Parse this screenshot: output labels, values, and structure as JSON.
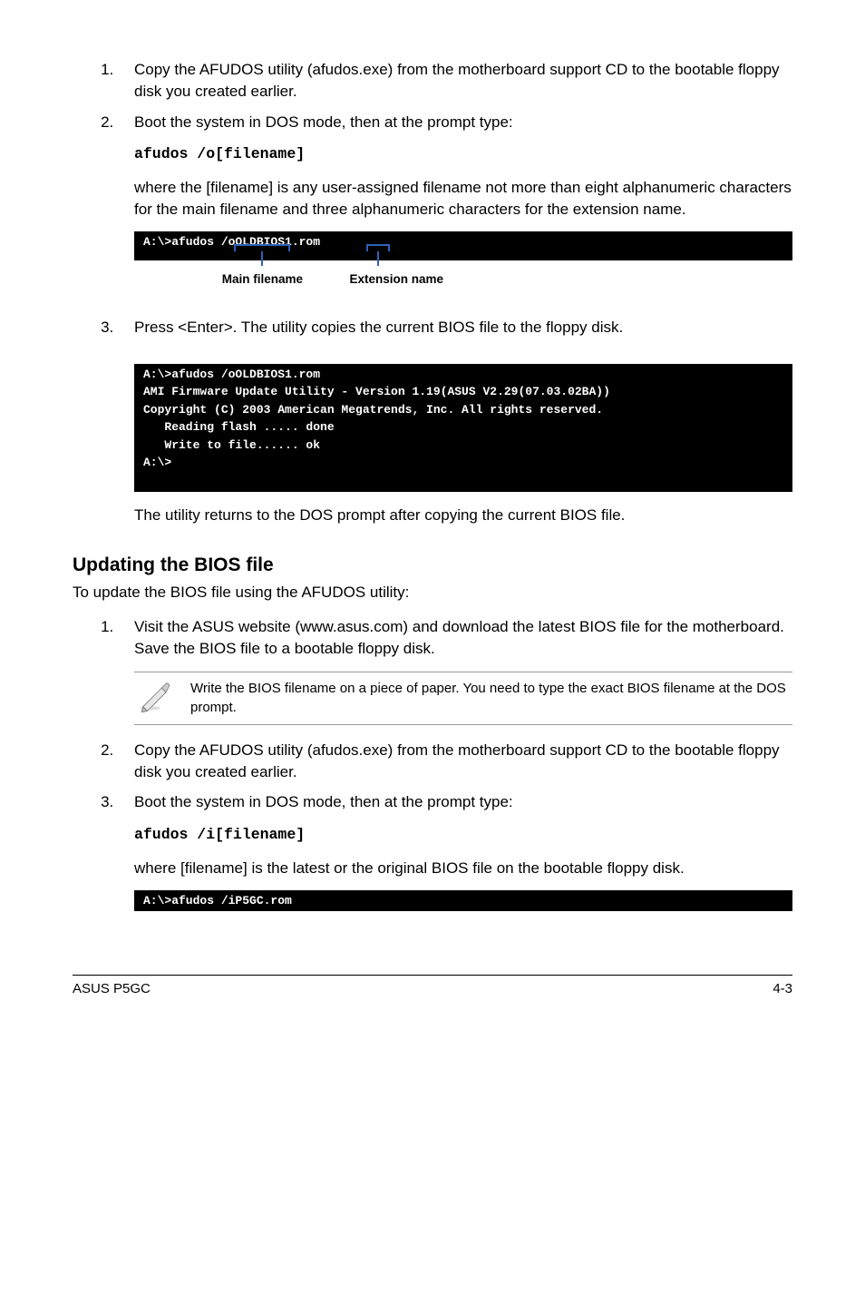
{
  "steps1": {
    "s1": "Copy the AFUDOS utility (afudos.exe) from the motherboard support CD to the bootable floppy disk you created earlier.",
    "s2": "Boot the system in DOS mode, then at the prompt type:",
    "s3": "Press <Enter>. The utility copies the current BIOS file to the floppy disk."
  },
  "code1": "afudos /o[filename]",
  "where1": "where the [filename] is any user-assigned filename not more than eight alphanumeric characters  for the main filename and three alphanumeric characters for the extension name.",
  "term1": "A:\\>afudos /oOLDBIOS1.rom",
  "annot": {
    "main": "Main filename",
    "ext": "Extension name"
  },
  "term2": "A:\\>afudos /oOLDBIOS1.rom\nAMI Firmware Update Utility - Version 1.19(ASUS V2.29(07.03.02BA))\nCopyright (C) 2003 American Megatrends, Inc. All rights reserved.\n   Reading flash ..... done\n   Write to file...... ok\nA:\\>",
  "after_copy": "The utility returns to the DOS prompt after copying the current BIOS file.",
  "section2": "Updating the BIOS file",
  "section2_sub": "To update the BIOS file using the AFUDOS utility:",
  "steps2": {
    "s1": "Visit the ASUS website (www.asus.com) and download the latest BIOS file for the motherboard. Save the BIOS file to a bootable floppy disk.",
    "s2": "Copy the AFUDOS utility (afudos.exe) from the motherboard support CD to the bootable floppy disk you created earlier.",
    "s3": "Boot the system in DOS mode, then at the prompt type:"
  },
  "note": "Write the BIOS filename on a piece of paper. You need to type the exact BIOS filename at the DOS prompt.",
  "code2": "afudos /i[filename]",
  "where2": "where [filename] is the latest or the original BIOS file on the bootable floppy disk.",
  "term3": "A:\\>afudos /iP5GC.rom",
  "footer": {
    "left": "ASUS P5GC",
    "right": "4-3"
  },
  "chart_data": {
    "type": "table",
    "note": "document page; no chart"
  }
}
